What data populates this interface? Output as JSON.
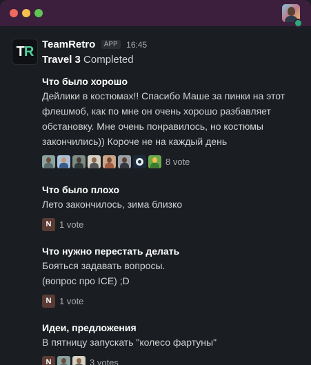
{
  "window": {
    "controls": [
      "close",
      "minimize",
      "maximize"
    ],
    "user_avatar_icon": "user-avatar-photo",
    "presence": "online"
  },
  "message": {
    "logo_text_1": "T",
    "logo_text_2": "R",
    "sender": "TeamRetro",
    "badge": "APP",
    "time": "16:45",
    "title_bold": "Travel 3",
    "title_rest": " Completed"
  },
  "sections": [
    {
      "heading": "Что было хорошо",
      "text": "Дейлики в костюмах!! Спасибо Маше за пинки на этот флешмоб, как по мне он очень хорошо разбавляет обстановку. Мне очень понравилось, но костюмы закончились)) Короче не на каждый день",
      "votes": "8 vote"
    },
    {
      "heading": "Что было плохо",
      "text": "Лето закончилось, зима близко",
      "votes": "1 vote"
    },
    {
      "heading": "Что нужно перестать делать",
      "text": "Бояться задавать вопросы.\n(вопрос про ICE) ;D",
      "votes": "1 vote"
    },
    {
      "heading": "Идеи, предложения",
      "text": "В пятницу запускать \"колесо фартуны\"",
      "votes": "3 votes"
    }
  ],
  "voter_avatar_initial": "N",
  "colors": {
    "titlebar": "#3b1f3d",
    "background": "#1a1d21",
    "accent": "#4ed19a",
    "presence": "#2bac76"
  }
}
